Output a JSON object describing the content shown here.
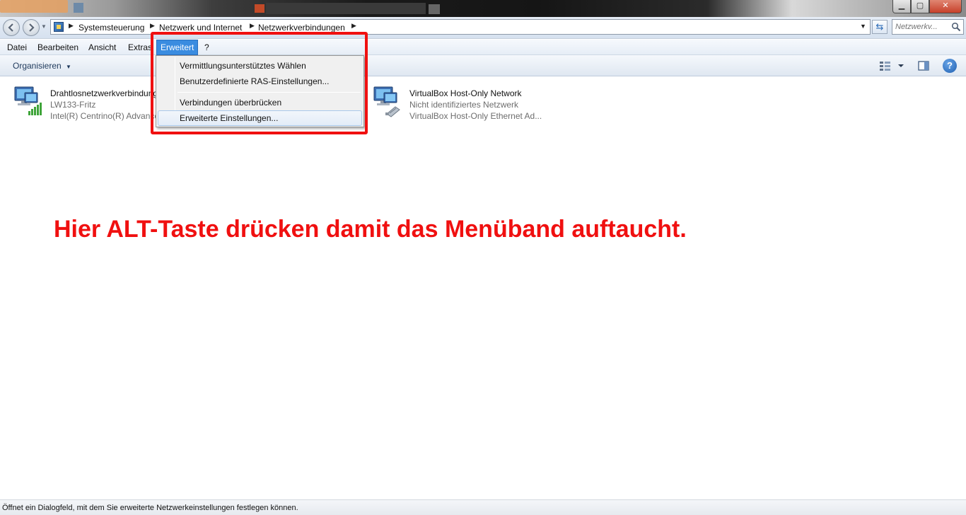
{
  "window": {
    "caption_buttons": {
      "minimize": "▁",
      "maximize": "▢",
      "close": "✕"
    }
  },
  "address": {
    "breadcrumbs": [
      "Systemsteuerung",
      "Netzwerk und Internet",
      "Netzwerkverbindungen"
    ],
    "search_placeholder": "Netzwerkv...",
    "refresh_icon": "⇆"
  },
  "menubar": {
    "items": [
      "Datei",
      "Bearbeiten",
      "Ansicht",
      "Extras",
      "Erweitert",
      "?"
    ],
    "active": "Erweitert"
  },
  "toolbar": {
    "organize_label": "Organisieren",
    "help_label": "?"
  },
  "dropdown": {
    "items": [
      "Vermittlungsunterstütztes Wählen",
      "Benutzerdefinierte RAS-Einstellungen...",
      "Verbindungen überbrücken",
      "Erweiterte Einstellungen..."
    ],
    "highlighted": "Erweiterte Einstellungen..."
  },
  "connections": [
    {
      "name": "Drahtlosnetzwerkverbindung",
      "status": "LW133-Fritz",
      "adapter": "Intel(R) Centrino(R) Advanced-N 6205"
    },
    {
      "name": "VirtualBox Host-Only Network",
      "status": "Nicht identifiziertes Netzwerk",
      "adapter": "VirtualBox Host-Only Ethernet Ad..."
    }
  ],
  "annotation": "Hier ALT-Taste drücken damit das Menüband auftaucht.",
  "statusbar": "Öffnet ein Dialogfeld, mit dem Sie erweiterte Netzwerkeinstellungen festlegen können.",
  "colors": {
    "annotation_red": "#f01010",
    "menu_active_blue": "#3a8ce0"
  }
}
